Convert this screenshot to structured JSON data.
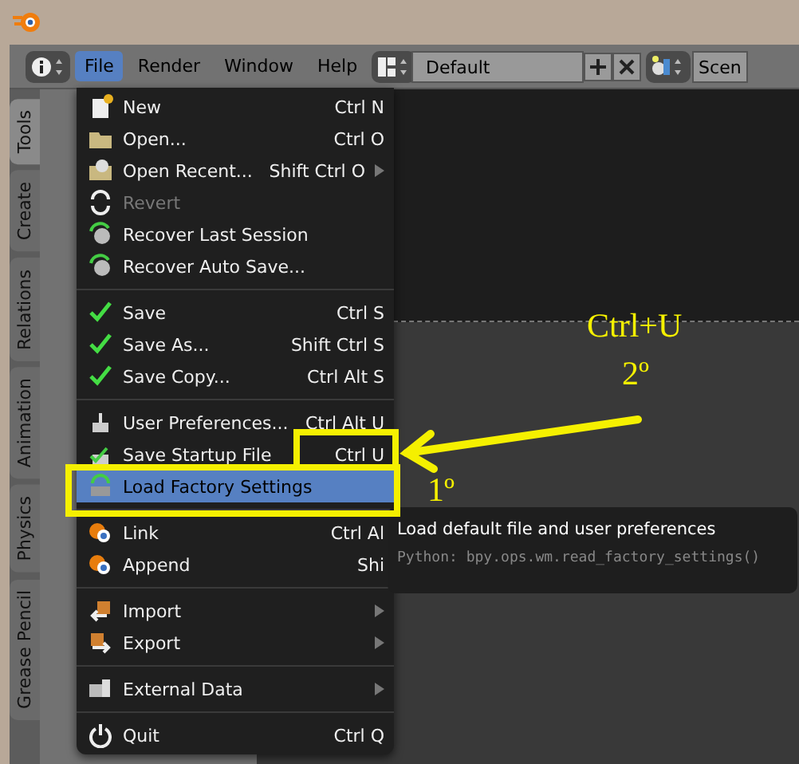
{
  "header": {
    "menus": [
      {
        "label": "File",
        "selected": true
      },
      {
        "label": "Render",
        "selected": false
      },
      {
        "label": "Window",
        "selected": false
      },
      {
        "label": "Help",
        "selected": false
      }
    ],
    "layout_field": {
      "value": "Default"
    },
    "scene_field": {
      "value": "Scen"
    }
  },
  "side_tabs": [
    {
      "label": "Tools",
      "selected": true
    },
    {
      "label": "Create",
      "selected": false
    },
    {
      "label": "Relations",
      "selected": false
    },
    {
      "label": "Animation",
      "selected": false
    },
    {
      "label": "Physics",
      "selected": false
    },
    {
      "label": "Grease Pencil",
      "selected": false
    }
  ],
  "file_menu": {
    "sections": [
      [
        {
          "label": "New",
          "shortcut": "Ctrl N",
          "submenu": false,
          "disabled": false,
          "selected": false
        },
        {
          "label": "Open...",
          "shortcut": "Ctrl O",
          "submenu": false,
          "disabled": false,
          "selected": false
        },
        {
          "label": "Open Recent...",
          "shortcut": "Shift Ctrl O",
          "submenu": true,
          "disabled": false,
          "selected": false
        },
        {
          "label": "Revert",
          "submenu": false,
          "disabled": true,
          "selected": false
        },
        {
          "label": "Recover Last Session",
          "submenu": false,
          "disabled": false,
          "selected": false
        },
        {
          "label": "Recover Auto Save...",
          "submenu": false,
          "disabled": false,
          "selected": false
        }
      ],
      [
        {
          "label": "Save",
          "shortcut": "Ctrl S",
          "submenu": false,
          "disabled": false,
          "selected": false
        },
        {
          "label": "Save As...",
          "shortcut": "Shift Ctrl S",
          "submenu": false,
          "disabled": false,
          "selected": false
        },
        {
          "label": "Save Copy...",
          "shortcut": "Ctrl Alt S",
          "submenu": false,
          "disabled": false,
          "selected": false
        }
      ],
      [
        {
          "label": "User Preferences...",
          "shortcut": "Ctrl Alt U",
          "submenu": false,
          "disabled": false,
          "selected": false
        },
        {
          "label": "Save Startup File",
          "shortcut": "Ctrl U",
          "submenu": false,
          "disabled": false,
          "selected": false
        },
        {
          "label": "Load Factory Settings",
          "submenu": false,
          "disabled": false,
          "selected": true
        }
      ],
      [
        {
          "label": "Link",
          "shortcut": "Ctrl Al",
          "submenu": false,
          "disabled": false,
          "selected": false
        },
        {
          "label": "Append",
          "shortcut": "Shi",
          "submenu": false,
          "disabled": false,
          "selected": false
        }
      ],
      [
        {
          "label": "Import",
          "submenu": true,
          "disabled": false,
          "selected": false
        },
        {
          "label": "Export",
          "submenu": true,
          "disabled": false,
          "selected": false
        }
      ],
      [
        {
          "label": "External Data",
          "submenu": true,
          "disabled": false,
          "selected": false
        }
      ],
      [
        {
          "label": "Quit",
          "shortcut": "Ctrl Q",
          "submenu": false,
          "disabled": false,
          "selected": false
        }
      ]
    ]
  },
  "tooltip": {
    "description": "Load default file and user preferences",
    "python": "Python: bpy.ops.wm.read_factory_settings()"
  },
  "annotations": {
    "shortcut_text": "Ctrl+U",
    "step_2": "2º",
    "step_1": "1º"
  }
}
